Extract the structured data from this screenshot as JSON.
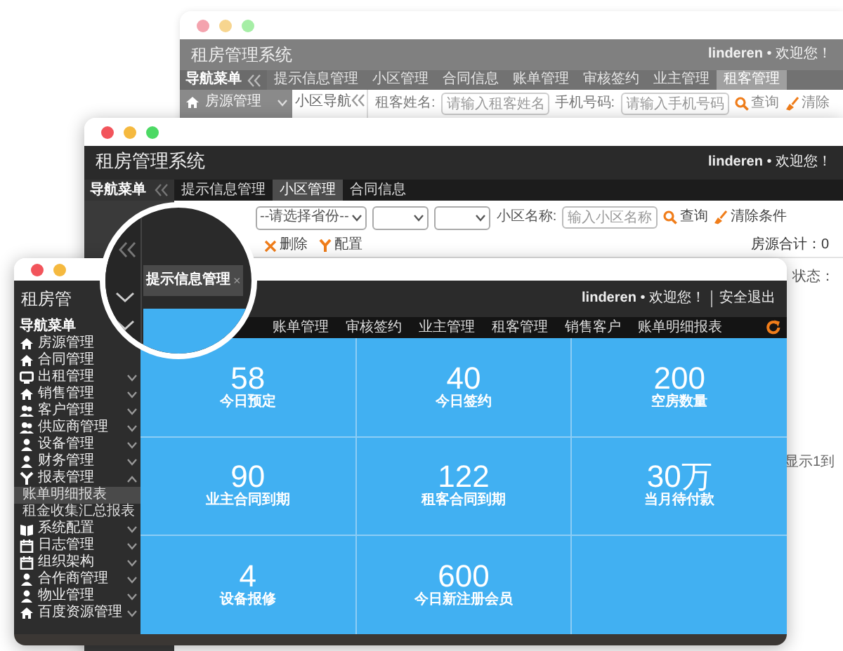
{
  "back_window": {
    "title": "租房管理系统",
    "greeting": "**linderen** • 欢迎您！",
    "nav_title": "导航菜单",
    "tabs": [
      {
        "label": "提示信息管理",
        "selected": false
      },
      {
        "label": "小区管理",
        "selected": false
      },
      {
        "label": "合同信息",
        "selected": false
      },
      {
        "label": "账单管理",
        "selected": false
      },
      {
        "label": "审核签约",
        "selected": false
      },
      {
        "label": "业主管理",
        "selected": false
      },
      {
        "label": "租客管理",
        "selected": true
      }
    ],
    "sidebar_items": [
      {
        "label": "房源管理"
      }
    ],
    "tree_title": "小区导航",
    "fields": [
      {
        "label": "租客姓名:",
        "placeholder": "请输入租客姓名"
      },
      {
        "label": "手机号码:",
        "placeholder": "请输入手机号码"
      }
    ],
    "buttons": [
      {
        "label": "查询",
        "kind": "search"
      },
      {
        "label": "清除",
        "kind": "clear"
      }
    ]
  },
  "middle_window": {
    "title": "租房管理系统",
    "greeting": "**linderen** • 欢迎您！",
    "nav_title": "导航菜单",
    "tabs": [
      {
        "label": "提示信息管理",
        "selected": false
      },
      {
        "label": "小区管理",
        "selected": true
      },
      {
        "label": "合同信息",
        "selected": false
      }
    ],
    "selects": [
      {
        "kind": "select",
        "value": "--请选择省份--"
      },
      {
        "kind": "select"
      },
      {
        "kind": "select"
      }
    ],
    "name_field": {
      "label": "小区名称:",
      "placeholder": "输入小区名称"
    },
    "buttons": [
      {
        "label": "查询",
        "kind": "search"
      },
      {
        "label": "清除条件",
        "kind": "clear"
      }
    ],
    "total": "房源合计：0",
    "toolbar": [
      {
        "label": "删除",
        "kind": "delete"
      },
      {
        "label": "配置",
        "kind": "config"
      }
    ],
    "column_label": "状态：",
    "pagination": "显示1到"
  },
  "front_window": {
    "sidebar_title": "租房管",
    "nav_title": "导航菜单",
    "menu": [
      {
        "label": "房源管理",
        "kind": "link"
      },
      {
        "label": "合同管理",
        "kind": "link"
      },
      {
        "label": "出租管理",
        "kind": "group",
        "expanded": false
      },
      {
        "label": "销售管理",
        "kind": "group",
        "expanded": false
      },
      {
        "label": "客户管理",
        "kind": "group",
        "expanded": false
      },
      {
        "label": "供应商管理",
        "kind": "group",
        "expanded": false
      },
      {
        "label": "设备管理",
        "kind": "group",
        "expanded": false
      },
      {
        "label": "财务管理",
        "kind": "group",
        "expanded": false
      },
      {
        "label": "报表管理",
        "kind": "group",
        "expanded": true,
        "children": [
          {
            "label": "账单明细报表",
            "selected": true
          },
          {
            "label": "租金收集汇总报表",
            "selected": false
          }
        ]
      },
      {
        "label": "系统配置",
        "kind": "group",
        "expanded": false
      },
      {
        "label": "日志管理",
        "kind": "group",
        "expanded": false
      },
      {
        "label": "组织架构",
        "kind": "group",
        "expanded": false
      },
      {
        "label": "合作商管理",
        "kind": "group",
        "expanded": false
      },
      {
        "label": "物业管理",
        "kind": "group",
        "expanded": false
      },
      {
        "label": "百度资源管理",
        "kind": "group",
        "expanded": false
      }
    ],
    "greeting": "**linderen** • 欢迎您！",
    "logout": "安全退出",
    "tabs": [
      {
        "label": "账单管理"
      },
      {
        "label": "审核签约"
      },
      {
        "label": "业主管理"
      },
      {
        "label": "租客管理"
      },
      {
        "label": "销售客户"
      },
      {
        "label": "账单明细报表"
      }
    ],
    "tiles": [
      {
        "value": "58",
        "label": "今日预定"
      },
      {
        "value": "40",
        "label": "今日签约"
      },
      {
        "value": "200",
        "label": "空房数量"
      },
      {
        "value": "90",
        "label": "业主合同到期"
      },
      {
        "value": "122",
        "label": "租客合同到期"
      },
      {
        "value": "30万",
        "label": "当月待付款"
      },
      {
        "value": "4",
        "label": "设备报修"
      },
      {
        "value": "600",
        "label": "今日新注册会员"
      }
    ]
  },
  "magnifier": {
    "tab_label": "提示信息管理",
    "tab_close": "×"
  }
}
